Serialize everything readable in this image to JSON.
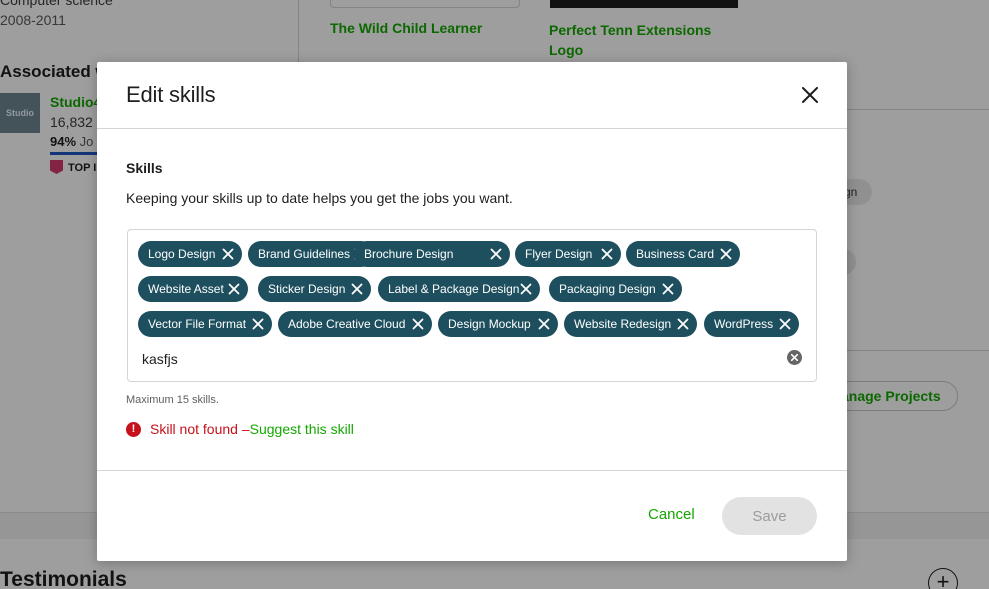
{
  "background": {
    "education_title": "Computer science",
    "education_years": "2008-2011",
    "project_1": "The Wild Child Learner",
    "project_2": "Perfect Tenn Extensions Logo",
    "associated_heading": "Associated w",
    "agency_logo_text": "Studio",
    "agency_name": "Studio4",
    "agency_earnings": "16,832",
    "agency_jss": "94%",
    "agency_jss_suffix": "Jo",
    "agency_badge": "TOP I",
    "right_chip_text": "gn",
    "manage_projects": "anage Projects",
    "testimonials_heading": "Testimonials",
    "add_icon": "+"
  },
  "modal": {
    "title": "Edit skills",
    "section_label": "Skills",
    "section_desc": "Keeping your skills up to date helps you get the jobs you want.",
    "skills": [
      "Logo Design",
      "Brand Guidelines",
      "Brochure Design",
      "Flyer Design",
      "Business Card",
      "Website Asset",
      "Sticker Design",
      "Label & Package Design",
      "Packaging Design",
      "Vector File Format",
      "Adobe Creative Cloud",
      "Design Mockup",
      "Website Redesign",
      "WordPress"
    ],
    "input_value": "kasfjs",
    "max_note": "Maximum 15 skills.",
    "error_text": "Skill not found – ",
    "error_link": "Suggest this skill",
    "error_icon": "!",
    "cancel_label": "Cancel",
    "save_label": "Save"
  },
  "colors": {
    "accent": "#14a800",
    "chip_bg": "#1e4f5e",
    "error": "#c7111c"
  },
  "icons": {
    "close": "close-icon",
    "chip_remove": "x-icon",
    "clear_input": "clear-circle-icon",
    "error": "exclamation-circle-icon"
  }
}
